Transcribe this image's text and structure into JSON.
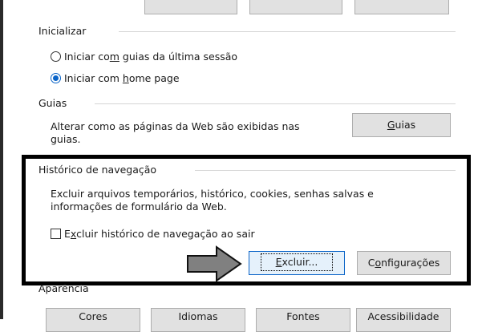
{
  "window": {
    "accent_color": "#0a64c8",
    "highlight_border_color": "#000000"
  },
  "sections": {
    "startup": {
      "title": "Inicializar",
      "options": [
        {
          "pre": "Iniciar co",
          "u": "m",
          "post": " guias da última sessão",
          "selected": false
        },
        {
          "pre": "Iniciar com ",
          "u": "h",
          "post": "ome page",
          "selected": true
        }
      ]
    },
    "tabs": {
      "title": "Guias",
      "description": "Alterar como as páginas da Web são exibidas nas guias.",
      "button": {
        "u": "G",
        "post": "uias"
      }
    },
    "history": {
      "title": "Histórico de navegação",
      "description": "Excluir arquivos temporários, histórico, cookies, senhas salvas e informações de formulário da Web.",
      "checkbox": {
        "pre": "E",
        "u": "x",
        "post": "cluir histórico de navegação ao sair",
        "checked": false
      },
      "delete_button": {
        "u": "E",
        "post": "xcluir..."
      },
      "settings_button": {
        "pre": "C",
        "u": "o",
        "post": "nfigurações"
      }
    },
    "appearance": {
      "title": "Aparência",
      "buttons": [
        "Cores",
        "Idiomas",
        "Fontes",
        "Acessibilidade"
      ]
    }
  },
  "annotation": {
    "arrow_icon": "arrow-right-icon",
    "arrow_color": "#808080"
  }
}
